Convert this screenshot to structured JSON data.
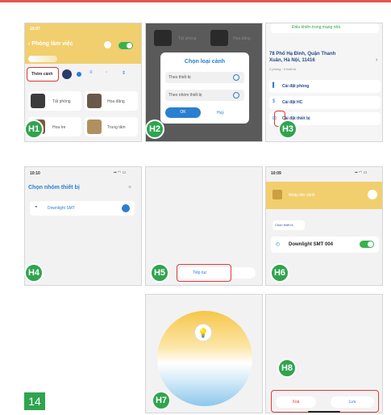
{
  "labels": {
    "h1": "H1",
    "h2": "H2",
    "h3": "H3",
    "h4": "H4",
    "h5": "H5",
    "h6": "H6",
    "h7": "H7",
    "h8": "H8"
  },
  "page_number": "14",
  "h1": {
    "status_time": "10:07",
    "title": "Phòng làm việc",
    "add_scene": "Thêm cảnh",
    "rooms": [
      "Tất phòng",
      "Hoa đăng",
      "Hoa tre",
      "Trung tâm"
    ]
  },
  "h2": {
    "bg_items": [
      "Tất phòng",
      "Hoa đăng"
    ],
    "dialog_title": "Chọn loại cảnh",
    "option1": "Theo thiết bị",
    "option2": "Theo nhóm thiết bị",
    "ok": "OK",
    "cancel": "Huỷ"
  },
  "h3": {
    "top_text": "Điều khiển trong mạng nhà",
    "address_line1": "78 Phố Hạ Đình, Quận Thanh",
    "address_line2": "Xuân, Hà Nội, 11416",
    "rooms_info": "2 phòng · 0 thiết bị",
    "menu": [
      "Cài đặt phòng",
      "Cài đặt HC",
      "Cài đặt thiết bị"
    ]
  },
  "h4": {
    "status_time": "10:10",
    "title": "Chọn nhóm thiết bị",
    "device": "Downlight SMT"
  },
  "h5": {
    "button": "Tiếp tục"
  },
  "h6": {
    "status_time": "10:09",
    "scene_placeholder": "Nhập tên cảnh",
    "choose_device": "Chọn thiết bị",
    "device": "Downlight SMT 004"
  },
  "h8": {
    "delete": "Xoá",
    "save": "Lưu"
  },
  "colors": {
    "badge": "#2fa44f",
    "accent_yellow": "#f3d57a",
    "highlight_red": "#e03a3a",
    "toggle": "#37b24d",
    "link_blue": "#2a7fd0"
  }
}
